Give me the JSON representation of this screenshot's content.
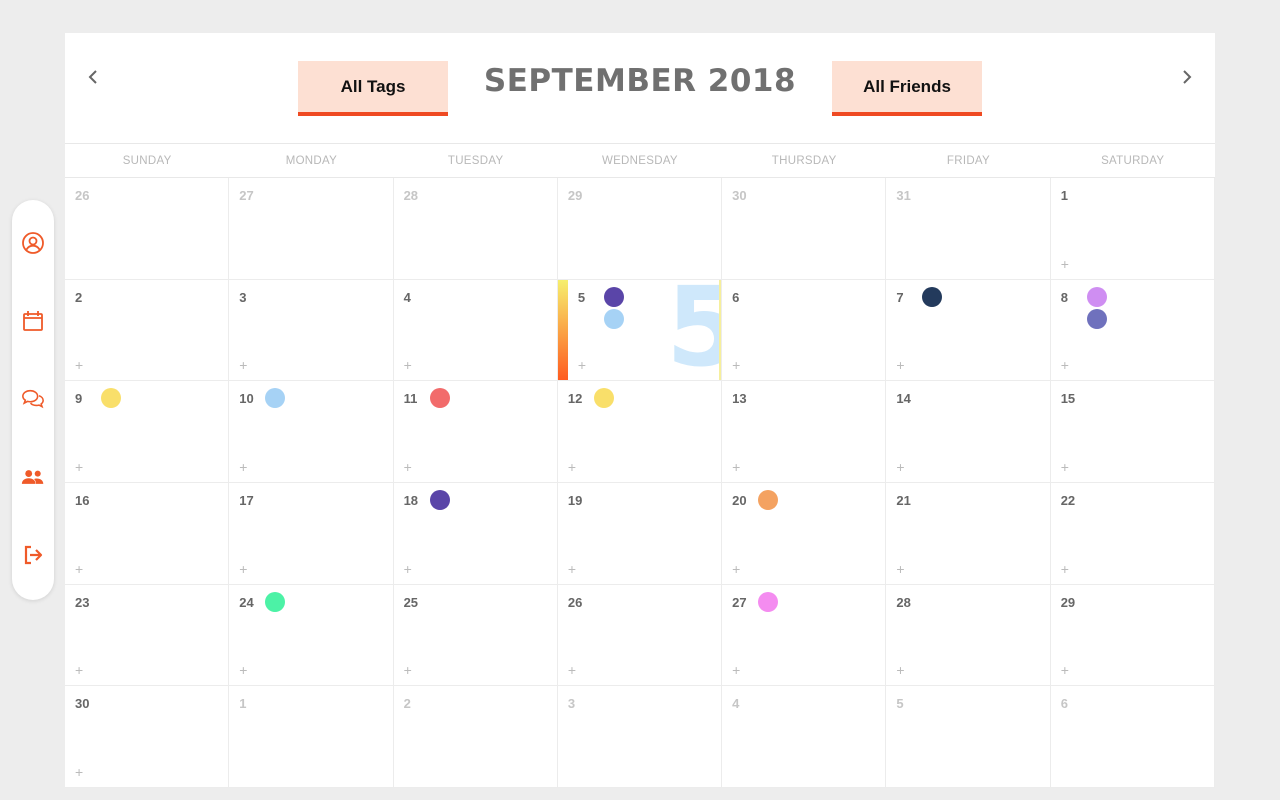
{
  "sidebar": {
    "items": [
      {
        "icon": "user-circle-icon"
      },
      {
        "icon": "calendar-icon"
      },
      {
        "icon": "chat-bubbles-icon"
      },
      {
        "icon": "friends-icon"
      },
      {
        "icon": "logout-icon"
      }
    ],
    "accent": "#ef5a29"
  },
  "header": {
    "title": "SEPTEMBER 2018",
    "tags_filter": "All Tags",
    "friends_filter": "All Friends",
    "prev_icon": "chevron-left-icon",
    "next_icon": "chevron-right-icon"
  },
  "weekdays": [
    "SUNDAY",
    "MONDAY",
    "TUESDAY",
    "WEDNESDAY",
    "THURSDAY",
    "FRIDAY",
    "SATURDAY"
  ],
  "today": {
    "big_label": "5",
    "gradient": [
      "#f6ef6d",
      "#ff5a1f"
    ]
  },
  "weeks": [
    [
      {
        "d": "26",
        "other": true
      },
      {
        "d": "27",
        "other": true
      },
      {
        "d": "28",
        "other": true
      },
      {
        "d": "29",
        "other": true
      },
      {
        "d": "30",
        "other": true
      },
      {
        "d": "31",
        "other": true
      },
      {
        "d": "1",
        "plus": true
      }
    ],
    [
      {
        "d": "2",
        "plus": true
      },
      {
        "d": "3",
        "plus": true
      },
      {
        "d": "4",
        "plus": true
      },
      {
        "d": "5",
        "plus": true,
        "today": true,
        "dots": [
          "#5a45a8",
          "#a6d2f5"
        ]
      },
      {
        "d": "6",
        "plus": true
      },
      {
        "d": "7",
        "plus": true,
        "dots": [
          "#233a5c"
        ]
      },
      {
        "d": "8",
        "plus": true,
        "dots": [
          "#cf8ef2",
          "#6f71bd"
        ]
      }
    ],
    [
      {
        "d": "9",
        "plus": true,
        "dots": [
          "#f9df6a"
        ]
      },
      {
        "d": "10",
        "plus": true,
        "dots": [
          "#a6d2f5"
        ]
      },
      {
        "d": "11",
        "plus": true,
        "dots": [
          "#f26b6b"
        ]
      },
      {
        "d": "12",
        "plus": true,
        "dots": [
          "#f9df6a"
        ]
      },
      {
        "d": "13",
        "plus": true
      },
      {
        "d": "14",
        "plus": true
      },
      {
        "d": "15",
        "plus": true
      }
    ],
    [
      {
        "d": "16",
        "plus": true
      },
      {
        "d": "17",
        "plus": true
      },
      {
        "d": "18",
        "plus": true,
        "dots": [
          "#5a45a8"
        ]
      },
      {
        "d": "19",
        "plus": true
      },
      {
        "d": "20",
        "plus": true,
        "dots": [
          "#f4a261"
        ]
      },
      {
        "d": "21",
        "plus": true
      },
      {
        "d": "22",
        "plus": true
      }
    ],
    [
      {
        "d": "23",
        "plus": true
      },
      {
        "d": "24",
        "plus": true,
        "dots": [
          "#4cf2a6"
        ]
      },
      {
        "d": "25",
        "plus": true
      },
      {
        "d": "26",
        "plus": true
      },
      {
        "d": "27",
        "plus": true,
        "dots": [
          "#f48cf0"
        ]
      },
      {
        "d": "28",
        "plus": true
      },
      {
        "d": "29",
        "plus": true
      }
    ],
    [
      {
        "d": "30",
        "plus": true
      },
      {
        "d": "1",
        "other": true
      },
      {
        "d": "2",
        "other": true
      },
      {
        "d": "3",
        "other": true
      },
      {
        "d": "4",
        "other": true
      },
      {
        "d": "5",
        "other": true
      },
      {
        "d": "6",
        "other": true
      }
    ]
  ],
  "plus_label": "+"
}
